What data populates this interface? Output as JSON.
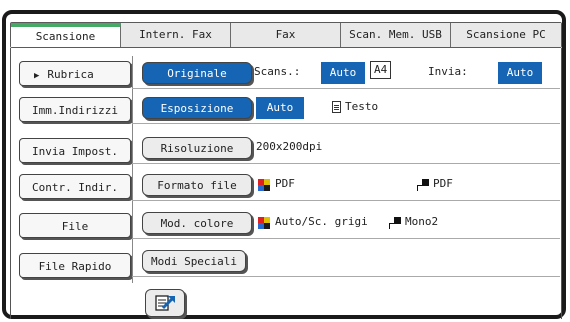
{
  "tabs": [
    "Scansione",
    "Intern. Fax",
    "Fax",
    "Scan. Mem. USB",
    "Scansione PC"
  ],
  "sidebar": {
    "items": [
      {
        "label": "Rubrica",
        "triangle": "▶"
      },
      {
        "label": "Imm.Indirizzi"
      },
      {
        "label": "Invia Impost."
      },
      {
        "label": "Contr. Indir."
      },
      {
        "label": "File"
      },
      {
        "label": "File Rapido"
      }
    ]
  },
  "settings": {
    "originale": {
      "button": "Originale",
      "scans_label": "Scans.:",
      "scans_value": "Auto",
      "paper_size": "A4",
      "invia_label": "Invia:",
      "invia_value": "Auto"
    },
    "esposizione": {
      "button": "Esposizione",
      "value": "Auto",
      "mode": "Testo"
    },
    "risoluzione": {
      "button": "Risoluzione",
      "value": "200x200dpi"
    },
    "formato_file": {
      "button": "Formato file",
      "color_format": "PDF",
      "mono_format": "PDF"
    },
    "mod_colore": {
      "button": "Mod. colore",
      "color_mode": "Auto/Sc. grigi",
      "mono_mode": "Mono2"
    },
    "modi_speciali": {
      "button": "Modi Speciali"
    }
  },
  "colors": {
    "accent": "#1565b4",
    "active_tab": "#44aa66"
  },
  "icons": {
    "color_icon": "color-quad-icon",
    "mono_icon": "mono-icon",
    "doc_icon": "document-icon",
    "action_icon": "send-arrow-icon"
  }
}
